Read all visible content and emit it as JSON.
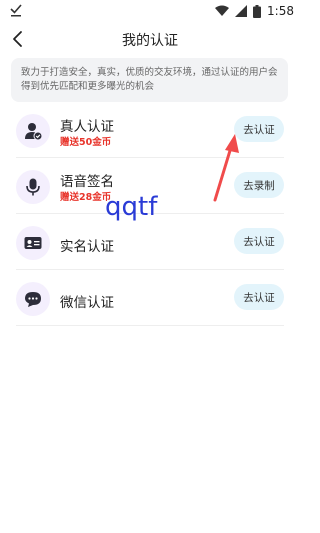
{
  "status_bar": {
    "time": "1:58",
    "left_icon": "check-download-icon",
    "icons": [
      "wifi-icon",
      "signal-icon",
      "battery-icon"
    ]
  },
  "header": {
    "title": "我的认证",
    "back_icon": "chevron-left-icon"
  },
  "notice": {
    "text": "致力于打造安全，真实，优质的交友环境，通过认证的用户会得到优先匹配和更多曝光的机会"
  },
  "items": [
    {
      "title": "真人认证",
      "subtitle": "赠送50金币",
      "button": "去认证",
      "icon": "person-check-icon"
    },
    {
      "title": "语音签名",
      "subtitle": "赠送28金币",
      "button": "去录制",
      "icon": "microphone-icon"
    },
    {
      "title": "实名认证",
      "subtitle": "",
      "button": "去认证",
      "icon": "id-card-icon"
    },
    {
      "title": "微信认证",
      "subtitle": "",
      "button": "去认证",
      "icon": "chat-bubble-icon"
    }
  ],
  "watermark": "qqtf",
  "colors": {
    "accent_red": "#e8352c",
    "button_bg": "#e3f4fb",
    "icon_bg": "#f4effd",
    "icon_fg": "#2d2d3a",
    "arrow": "#f04b4b"
  }
}
